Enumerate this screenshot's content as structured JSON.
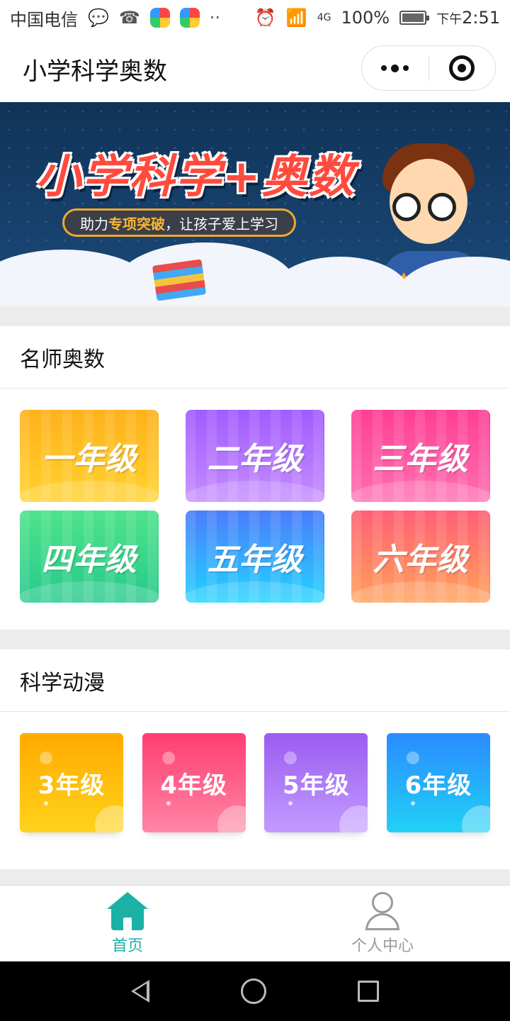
{
  "status_bar": {
    "carrier": "中国电信",
    "network": "4G",
    "battery": "100%",
    "time_prefix": "下午",
    "time": "2:51"
  },
  "header": {
    "title": "小学科学奥数"
  },
  "banner": {
    "title": "小学科学+奥数",
    "slogan_prefix": "助力",
    "slogan_highlight": "专项突破",
    "slogan_suffix": "，让孩子爱上学习"
  },
  "section_olympiad": {
    "title": "名师奥数",
    "grades": [
      {
        "label": "一年级",
        "color_top": "#ffb11b",
        "color_bottom": "#ffd22e"
      },
      {
        "label": "二年级",
        "color_top": "#a25cff",
        "color_bottom": "#c48bff"
      },
      {
        "label": "三年级",
        "color_top": "#ff3f95",
        "color_bottom": "#ff6fb0"
      },
      {
        "label": "四年级",
        "color_top": "#4fe38a",
        "color_bottom": "#26c98b"
      },
      {
        "label": "五年级",
        "color_top": "#4c7dfb",
        "color_bottom": "#21d3ff"
      },
      {
        "label": "六年级",
        "color_top": "#ff6175",
        "color_bottom": "#ffa05a"
      }
    ]
  },
  "section_anime": {
    "title": "科学动漫",
    "grades": [
      {
        "label": "3年级",
        "color_top": "#ffaa00",
        "color_bottom": "#ffd21a"
      },
      {
        "label": "4年级",
        "color_top": "#ff3e71",
        "color_bottom": "#ff85a6"
      },
      {
        "label": "5年级",
        "color_top": "#9a5cf0",
        "color_bottom": "#c39bff"
      },
      {
        "label": "6年级",
        "color_top": "#2a8bff",
        "color_bottom": "#22d1f5"
      }
    ]
  },
  "tab_bar": {
    "tabs": [
      {
        "label": "首页",
        "icon": "home-icon",
        "active": true
      },
      {
        "label": "个人中心",
        "icon": "user-icon",
        "active": false
      }
    ],
    "active_color": "#1bb1a6"
  }
}
